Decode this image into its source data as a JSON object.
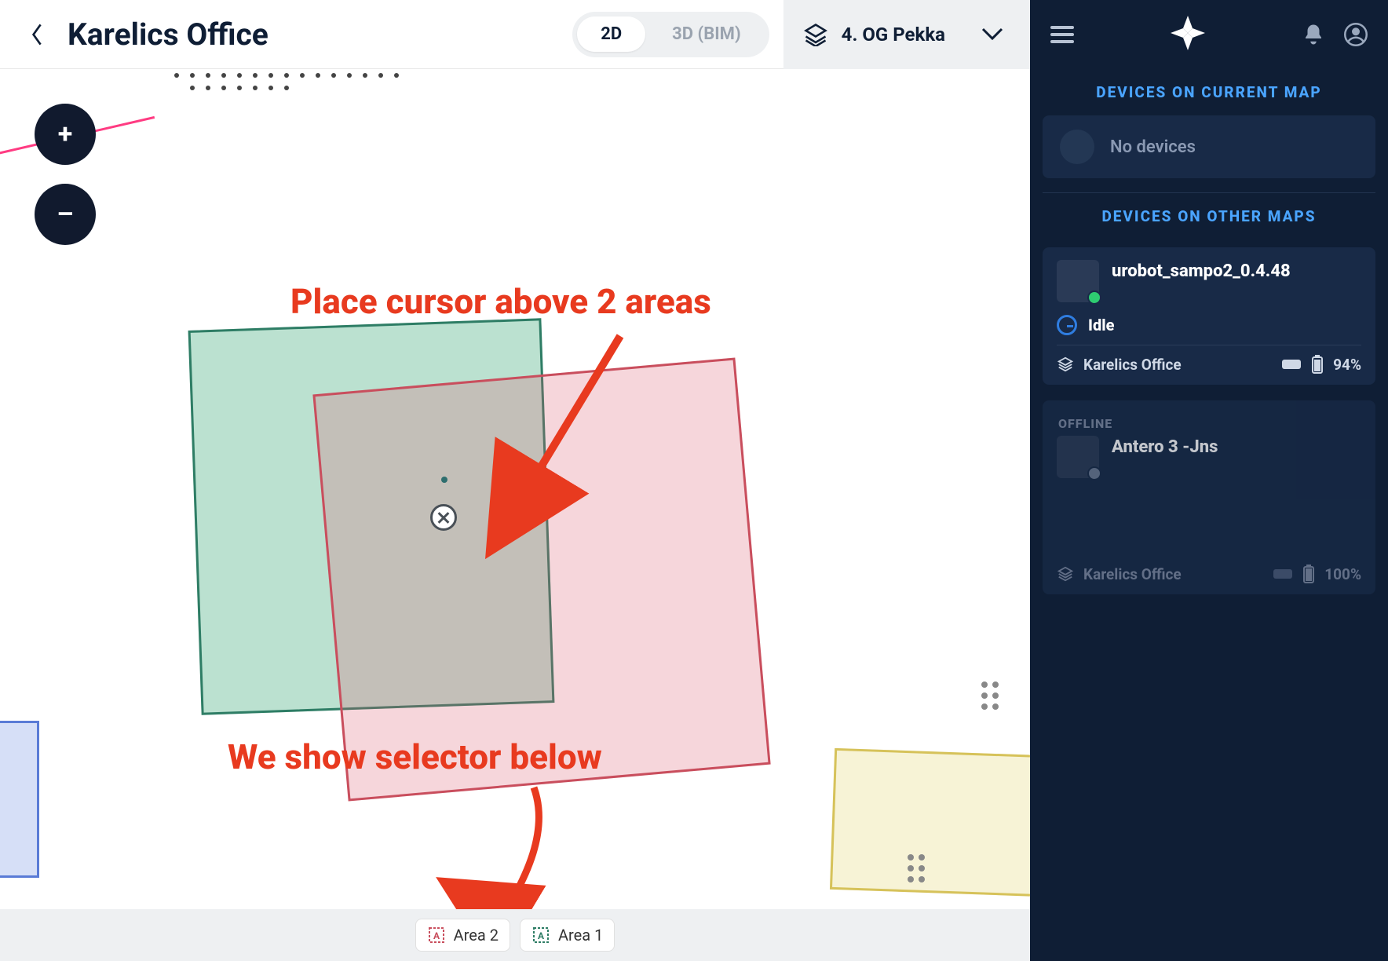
{
  "header": {
    "title": "Karelics Office",
    "view_tabs": {
      "two_d": "2D",
      "three_d": "3D (BIM)"
    },
    "floor_label": "4. OG Pekka"
  },
  "zoom": {
    "in": "+",
    "out": "–"
  },
  "annotations": {
    "top": "Place cursor above 2 areas",
    "bottom": "We show selector below"
  },
  "selector": {
    "items": [
      {
        "label": "Area 2",
        "color": "#c94e5d"
      },
      {
        "label": "Area 1",
        "color": "#2e7d65"
      }
    ]
  },
  "side": {
    "section_current": "DEVICES ON CURRENT MAP",
    "no_devices": "No devices",
    "section_other": "DEVICES ON OTHER MAPS",
    "devices": [
      {
        "name": "urobot_sampo2_0.4.48",
        "status": "Idle",
        "location": "Karelics Office",
        "battery": "94%",
        "online": true
      },
      {
        "offline_label": "OFFLINE",
        "name": "Antero 3 -Jns",
        "location": "Karelics Office",
        "battery": "100%",
        "online": false
      }
    ]
  }
}
